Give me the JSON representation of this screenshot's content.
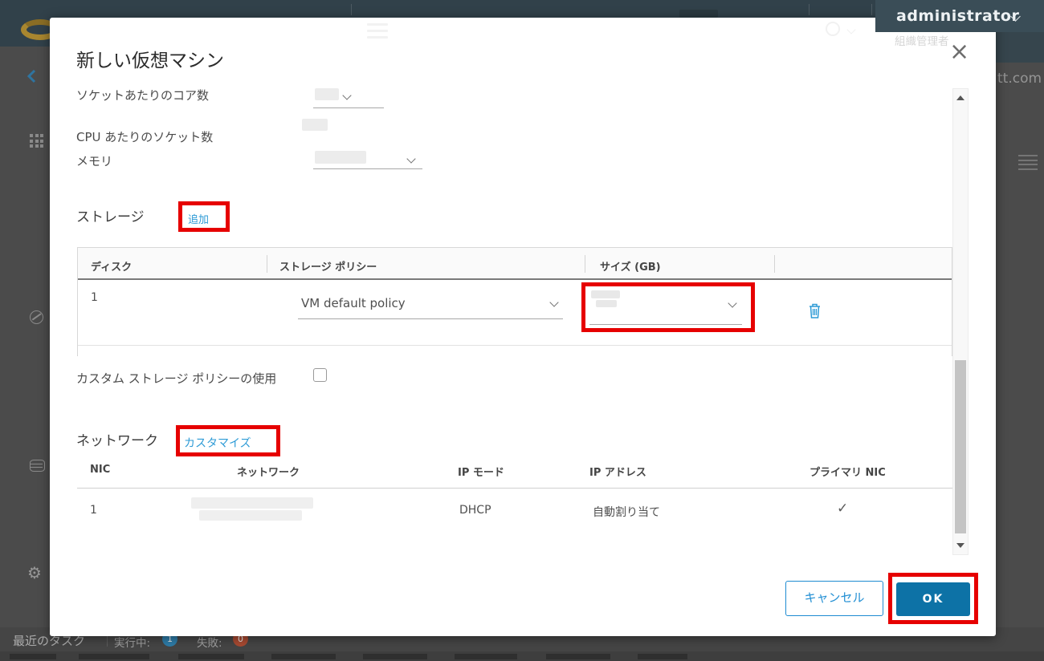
{
  "header": {
    "user": "administrator",
    "user_role": "組織管理者",
    "host_suffix": "tt.com"
  },
  "modal": {
    "title": "新しい仮想マシン",
    "close": "×",
    "fields": {
      "cores_label": "ソケットあたりのコア数",
      "sockets_label": "CPU あたりのソケット数",
      "memory_label": "メモリ"
    },
    "storage": {
      "heading": "ストレージ",
      "add_label": "追加",
      "columns": [
        "ディスク",
        "ストレージ ポリシー",
        "サイズ (GB)"
      ],
      "row": {
        "disk": "1",
        "policy": "VM default policy"
      }
    },
    "custom_policy_label": "カスタム ストレージ ポリシーの使用",
    "network": {
      "heading": "ネットワーク",
      "customize_label": "カスタマイズ",
      "columns": [
        "NIC",
        "ネットワーク",
        "IP モード",
        "IP アドレス",
        "プライマリ NIC"
      ],
      "row": {
        "nic": "1",
        "ip_mode": "DHCP",
        "ip_address": "自動割り当て",
        "primary": "✓"
      }
    },
    "footer": {
      "cancel": "キャンセル",
      "ok": "OK"
    }
  },
  "taskbar": {
    "recent_tasks": "最近のタスク",
    "running_label": "実行中:",
    "running_count": "1",
    "failed_label": "失敗:",
    "failed_count": "0"
  },
  "colors": {
    "link_blue": "#2e9bd6",
    "ok_blue": "#0d72a6",
    "annotation_red": "#e60000",
    "header_teal": "#31414a"
  }
}
